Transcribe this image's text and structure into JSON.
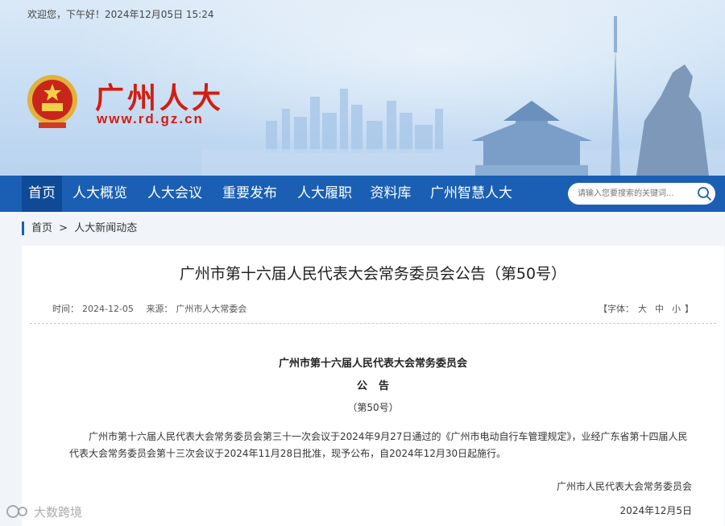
{
  "header": {
    "greeting": "欢迎您，下午好！2024年12月05日 15:24",
    "site_title": "广州人大",
    "site_url": "www.rd.gz.cn"
  },
  "nav": {
    "items": [
      {
        "label": "首页"
      },
      {
        "label": "人大概览"
      },
      {
        "label": "人大会议"
      },
      {
        "label": "重要发布"
      },
      {
        "label": "人大履职"
      },
      {
        "label": "资料库"
      },
      {
        "label": "广州智慧人大"
      }
    ],
    "search_placeholder": "请输入您要搜索的关键词..."
  },
  "breadcrumb": {
    "home": "首页",
    "sep": ">",
    "current": "人大新闻动态"
  },
  "article": {
    "title": "广州市第十六届人民代表大会常务委员会公告（第50号）",
    "time_label": "时间：",
    "time": "2024-12-05",
    "source_label": "来源：",
    "source": "广州市人大常委会",
    "fontsize_open": "【字体：",
    "fontsize_large": "大",
    "fontsize_medium": "中",
    "fontsize_small": "小",
    "fontsize_close": "】",
    "org": "广州市第十六届人民代表大会常务委员会",
    "notice": "公告",
    "number": "（第50号）",
    "body": "广州市第十六届人民代表大会常务委员会第三十一次会议于2024年9月27日通过的《广州市电动自行车管理规定》，业经广东省第十四届人民代表大会常务委员会第十三次会议于2024年11月28日批准，现予公布，自2024年12月30日起施行。",
    "signature": "广州市人民代表大会常务委员会",
    "sign_date": "2024年12月5日"
  },
  "watermark": {
    "text": "大数跨境"
  },
  "colors": {
    "nav": "#1a5fb4",
    "nav_active": "#0f4a96",
    "brand_red": "#d31d12"
  }
}
